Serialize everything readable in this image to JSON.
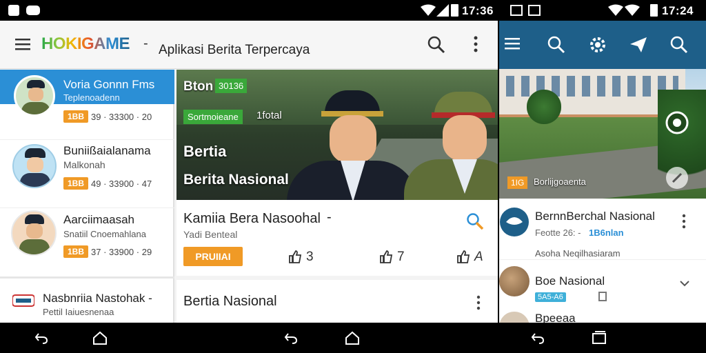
{
  "status_left": {
    "time": "17:36"
  },
  "status_right": {
    "time": "17:24"
  },
  "app": {
    "logo": "HOKIGAME",
    "logo_dash": "-",
    "tagline": "Aplikasi Berita Terpercaya"
  },
  "sidebar": {
    "items": [
      {
        "title": "Voria Gonnn Fms",
        "subtitle": "Teplenoadenn",
        "badge": "1BB",
        "meta": "39 · 33300 · 20"
      },
      {
        "title": "Buniißaialanama",
        "subtitle": "Malkonah",
        "badge": "1BB",
        "meta": "49 · 33900 · 47"
      },
      {
        "title": "Aarciimaasah",
        "subtitle": "Snatiil Cnoemahlana",
        "badge": "1BB",
        "meta": "37 · 33900 · 29"
      },
      {
        "title": "Nasbnriia Nastohak -",
        "subtitle": "Pettil Iaiuesnenaa"
      }
    ]
  },
  "hero": {
    "tag": "Bton",
    "tag_badge": "30136",
    "label_green": "Sortmoieane",
    "label_white": "1fotal",
    "title1": "Bertia",
    "title2": "Berita Nasional"
  },
  "card1": {
    "title": "Kamiia Bera Nasoohal",
    "dash": "-",
    "subtitle": "Yadi Benteal",
    "button": "PRUIIAI",
    "likes": [
      "3",
      "7",
      "A"
    ]
  },
  "card2": {
    "title": "Bertia Nasional"
  },
  "right": {
    "hero_badge_tag": "1IG",
    "hero_badge_text": "Borlijgoaenta",
    "items": [
      {
        "title": "BernnBerchal Nasional",
        "meta_grey": "Feotte 26: -",
        "meta_blue": "1B6nlan",
        "desc": "Asoha Neqilhasiaram"
      },
      {
        "title": "Boe Nasional",
        "chip": "5A5-A6"
      },
      {
        "title": "Bpeeaa"
      }
    ]
  },
  "colors": {
    "accent_blue": "#2b8fd6",
    "right_bar": "#1e5f89",
    "orange": "#f09a26",
    "green_badge": "#3aa83a"
  }
}
